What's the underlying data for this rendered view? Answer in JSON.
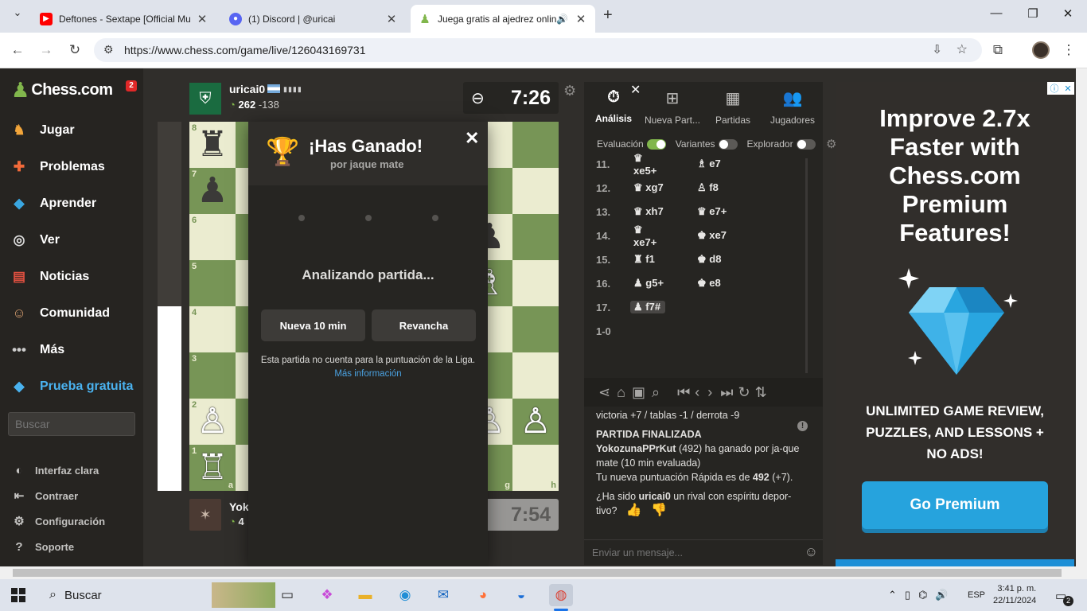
{
  "browser": {
    "tabs": [
      {
        "title": "Deftones - Sextape [Official Mu",
        "favicon": "youtube-icon",
        "color": "#ff0000"
      },
      {
        "title": "(1) Discord | @uricai",
        "favicon": "discord-icon",
        "color": "#5865f2"
      },
      {
        "title": "Juega gratis al ajedrez onlin",
        "favicon": "chess-pawn-icon",
        "color": "#81b64c"
      }
    ],
    "url": "https://www.chess.com/game/live/126043169731"
  },
  "sidebar": {
    "logo": "Chess.com",
    "notif_count": "2",
    "items": [
      {
        "label": "Jugar",
        "icon": "play-icon"
      },
      {
        "label": "Problemas",
        "icon": "puzzle-icon"
      },
      {
        "label": "Aprender",
        "icon": "learn-icon"
      },
      {
        "label": "Ver",
        "icon": "binoculars-icon"
      },
      {
        "label": "Noticias",
        "icon": "news-icon"
      },
      {
        "label": "Comunidad",
        "icon": "community-icon"
      },
      {
        "label": "Más",
        "icon": "more-icon"
      }
    ],
    "trial": "Prueba gratuita",
    "search_placeholder": "Buscar",
    "settings": [
      "Interfaz clara",
      "Contraer",
      "Configuración",
      "Soporte"
    ]
  },
  "top_player": {
    "name": "uricai0",
    "rating": "262",
    "change": "-138",
    "clock": "7:26"
  },
  "bottom_player": {
    "name": "Yoko",
    "rating": "4",
    "clock": "7:54"
  },
  "board": {
    "ranks": [
      "8",
      "7",
      "6",
      "5",
      "4",
      "3",
      "2",
      "1"
    ],
    "files": [
      "a",
      "g",
      "h"
    ]
  },
  "modal": {
    "title": "¡Has Ganado!",
    "subtitle": "por jaque mate",
    "analyzing": "Analizando partida...",
    "new_game": "Nueva 10 min",
    "rematch": "Revancha",
    "note": "Esta partida no cuenta para la puntuación de la Liga.",
    "more_info": "Más información"
  },
  "panel": {
    "tabs": [
      "Análisis",
      "Nueva Part...",
      "Partidas",
      "Jugadores"
    ],
    "toggles": [
      "Evaluación",
      "Variantes",
      "Explorador"
    ],
    "moves": [
      {
        "n": "11.",
        "w": "xe5+",
        "wp": "♛",
        "b": "e7",
        "bp": "♗"
      },
      {
        "n": "12.",
        "w": "xg7",
        "wp": "♛",
        "b": "f8",
        "bp": "♙"
      },
      {
        "n": "13.",
        "w": "xh7",
        "wp": "♛",
        "b": "e7+",
        "bp": "♛"
      },
      {
        "n": "14.",
        "w": "xe7+",
        "wp": "♛",
        "b": "xe7",
        "bp": "♚"
      },
      {
        "n": "15.",
        "w": "f1",
        "wp": "♜",
        "b": "d8",
        "bp": "♚"
      },
      {
        "n": "16.",
        "w": "g5+",
        "wp": "♟",
        "b": "e8",
        "bp": "♚"
      },
      {
        "n": "17.",
        "w": "f7#",
        "wp": "♟",
        "b": "",
        "bp": ""
      }
    ],
    "result": "1-0",
    "chat": {
      "line1": "victoria +7 / tablas -1 / derrota -9",
      "finalized": "PARTIDA FINALIZADA",
      "winner": "YokozunaPPrKut",
      "win_text": " (492) ha ganado por ja-que mate (10 min evaluada)",
      "rating_text": "Tu nueva puntuación Rápida es de ",
      "rating_value": "492",
      "rating_delta": " (+7).",
      "question_a": "¿Ha sido ",
      "question_user": "uricai0",
      "question_b": " un rival con espíritu depor-tivo?",
      "placeholder": "Enviar un mensaje..."
    }
  },
  "ad": {
    "headline": "Improve 2.7x Faster with Chess.com Premium Features!",
    "body": "UNLIMITED GAME REVIEW, PUZZLES, AND LESSONS + NO ADS!",
    "cta": "Go Premium"
  },
  "taskbar": {
    "search": "Buscar",
    "lang": "ESP",
    "time": "3:41 p. m.",
    "date": "22/11/2024",
    "notifications": "2"
  }
}
